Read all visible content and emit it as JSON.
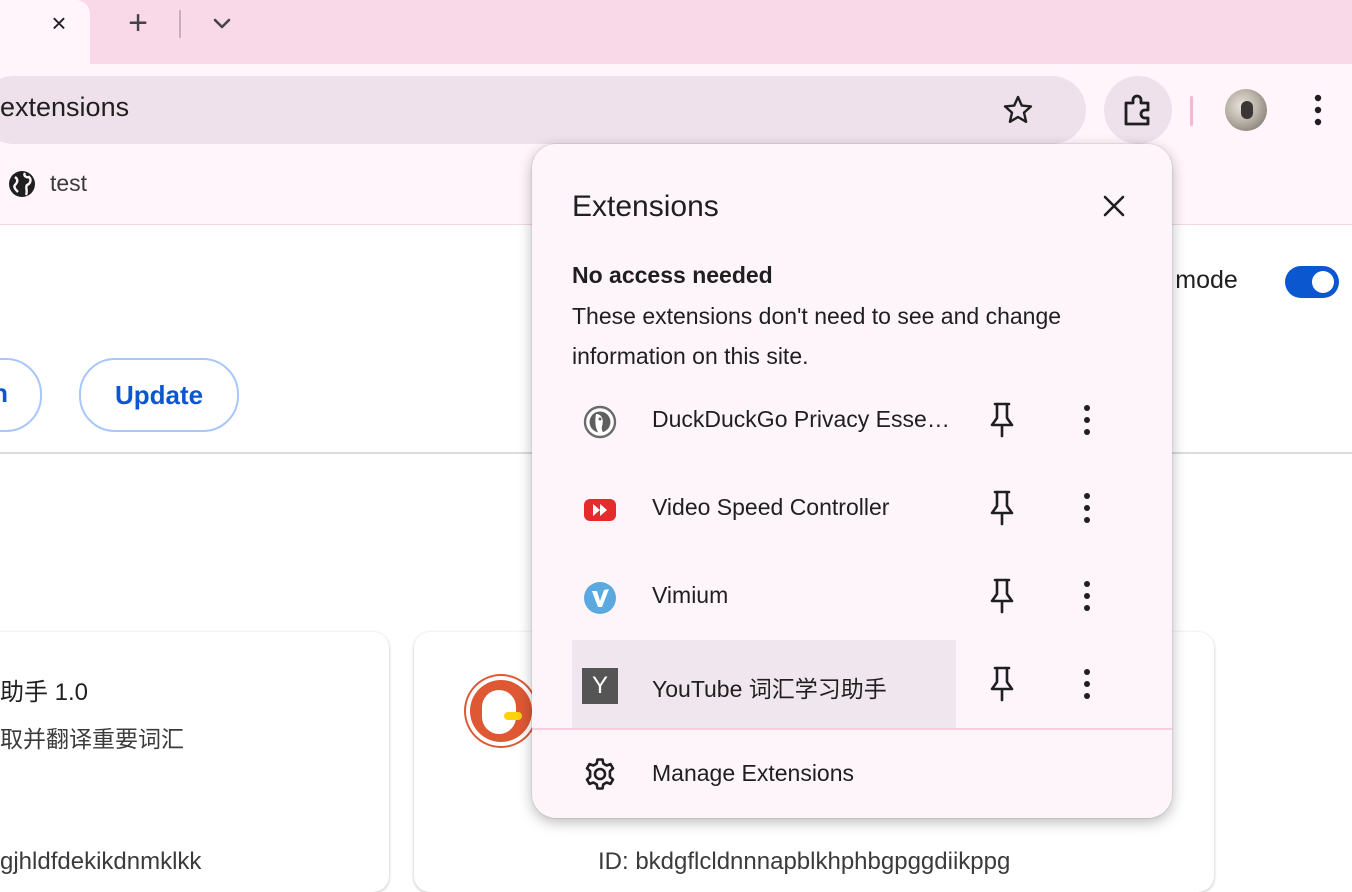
{
  "tabstrip": {
    "close_icon": "×",
    "new_tab_icon": "+"
  },
  "toolbar": {
    "omnibox_text": "extensions"
  },
  "bookmarks": {
    "items": [
      {
        "label": "test"
      }
    ]
  },
  "page": {
    "developer_mode_label": "r mode",
    "developer_mode_on": true,
    "left_button_label": "n",
    "update_button_label": "Update",
    "card1": {
      "title": "助手  1.0",
      "description": "取并翻译重要词汇",
      "id_text": "gjhldfdekikdnmklkk"
    },
    "card2": {
      "id_text": "ID: bkdgflcldnnnapblkhphbgpggdiikppg"
    }
  },
  "popup": {
    "title": "Extensions",
    "section_title": "No access needed",
    "section_description": "These extensions don't need to see and change information on this site.",
    "extensions": [
      {
        "name": "DuckDuckGo Privacy Essentials",
        "icon": "duckduckgo-icon"
      },
      {
        "name": "Video Speed Controller",
        "icon": "video-speed-controller-icon"
      },
      {
        "name": "Vimium",
        "icon": "vimium-icon"
      },
      {
        "name": "YouTube 词汇学习助手",
        "icon": "youtube-vocabulary-icon",
        "icon_letter": "Y"
      }
    ],
    "manage_label": "Manage Extensions"
  },
  "colors": {
    "accent": "#0b57d0",
    "tabstrip_bg": "#f9d9e8",
    "popup_bg": "#fdf5fa"
  }
}
